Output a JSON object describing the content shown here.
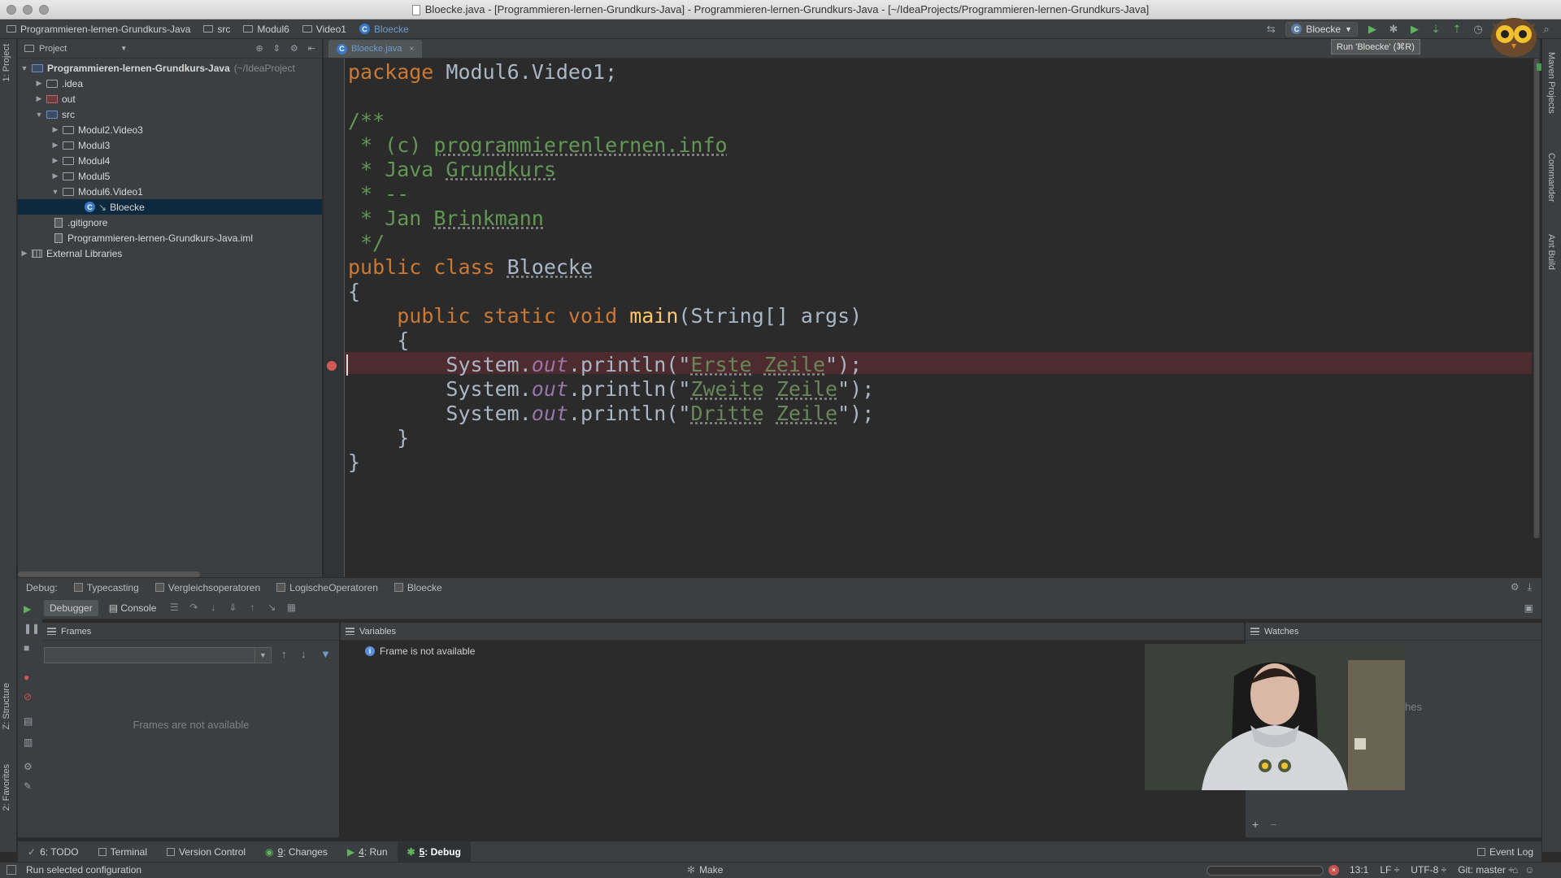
{
  "window": {
    "title": "Bloecke.java - [Programmieren-lernen-Grundkurs-Java] - Programmieren-lernen-Grundkurs-Java - [~/IdeaProjects/Programmieren-lernen-Grundkurs-Java]"
  },
  "navbar": {
    "crumbs": [
      "Programmieren-lernen-Grundkurs-Java",
      "src",
      "Modul6",
      "Video1",
      "Bloecke"
    ],
    "run_config": "Bloecke",
    "tooltip": "Run 'Bloecke' (⌘R)"
  },
  "left_stripe": {
    "project_tab": "1: Project",
    "structure_tab": "Z: Structure",
    "favorites_tab": "2: Favorites"
  },
  "right_stripe": {
    "maven": "Maven Projects",
    "commander": "Commander",
    "ant": "Ant Build"
  },
  "project": {
    "header": "Project",
    "root": {
      "name": "Programmieren-lernen-Grundkurs-Java",
      "path": "(~/IdeaProject"
    },
    "items": [
      {
        "label": ".idea"
      },
      {
        "label": "out"
      },
      {
        "label": "src"
      },
      {
        "label": "Modul2.Video3"
      },
      {
        "label": "Modul3"
      },
      {
        "label": "Modul4"
      },
      {
        "label": "Modul5"
      },
      {
        "label": "Modul6.Video1"
      },
      {
        "label": "Bloecke"
      },
      {
        "label": ".gitignore"
      },
      {
        "label": "Programmieren-lernen-Grundkurs-Java.iml"
      },
      {
        "label": "External Libraries"
      }
    ]
  },
  "editor": {
    "tab": "Bloecke.java",
    "code": {
      "l1_kw": "package",
      "l1_rest": " Modul6.Video1;",
      "l3": "/**",
      "l4_pre": " * (c) ",
      "l4_u": "programmierenlernen.info",
      "l5_pre": " * Java ",
      "l5_u": "Grundkurs",
      "l6": " * --",
      "l7_pre": " * Jan ",
      "l7_u": "Brinkmann",
      "l8": " */",
      "l9_kw": "public class ",
      "l9_name": "Bloecke",
      "l10": "{",
      "l11_indent": "    ",
      "l11_kw": "public static void ",
      "l11_fn": "main",
      "l11_rest": "(String[] args)",
      "l12": "    {",
      "sys": "        System.",
      "out": "out",
      "println_open": ".println(\"",
      "s1a": "Erste",
      "s1b": "Zeile",
      "s2a": "Zweite",
      "s2b": "Zeile",
      "s3a": "Dritte",
      "s3b": "Zeile",
      "close": "\");",
      "l16": "    }",
      "l17": "}"
    }
  },
  "debug": {
    "label": "Debug:",
    "tabs": [
      "Typecasting",
      "Vergleichsoperatoren",
      "LogischeOperatoren",
      "Bloecke"
    ],
    "subtabs": [
      "Debugger",
      "Console"
    ],
    "frames_header": "Frames",
    "frames_empty": "Frames are not available",
    "variables_header": "Variables",
    "variables_info": "Frame is not available",
    "watches_header": "Watches",
    "watches_partial": "hes"
  },
  "bottom_tabs": {
    "todo": "6: TODO",
    "terminal": "Terminal",
    "vcs": "Version Control",
    "changes_num": "9",
    "changes": ": Changes",
    "run_num": "4",
    "run": ": Run",
    "debug_num": "5",
    "debug": ": Debug",
    "event_log": "Event Log"
  },
  "status": {
    "message": "Run selected configuration",
    "make": "Make",
    "position": "13:1",
    "line_sep": "LF ÷",
    "encoding": "UTF-8 ÷",
    "git": "Git: master ÷"
  }
}
